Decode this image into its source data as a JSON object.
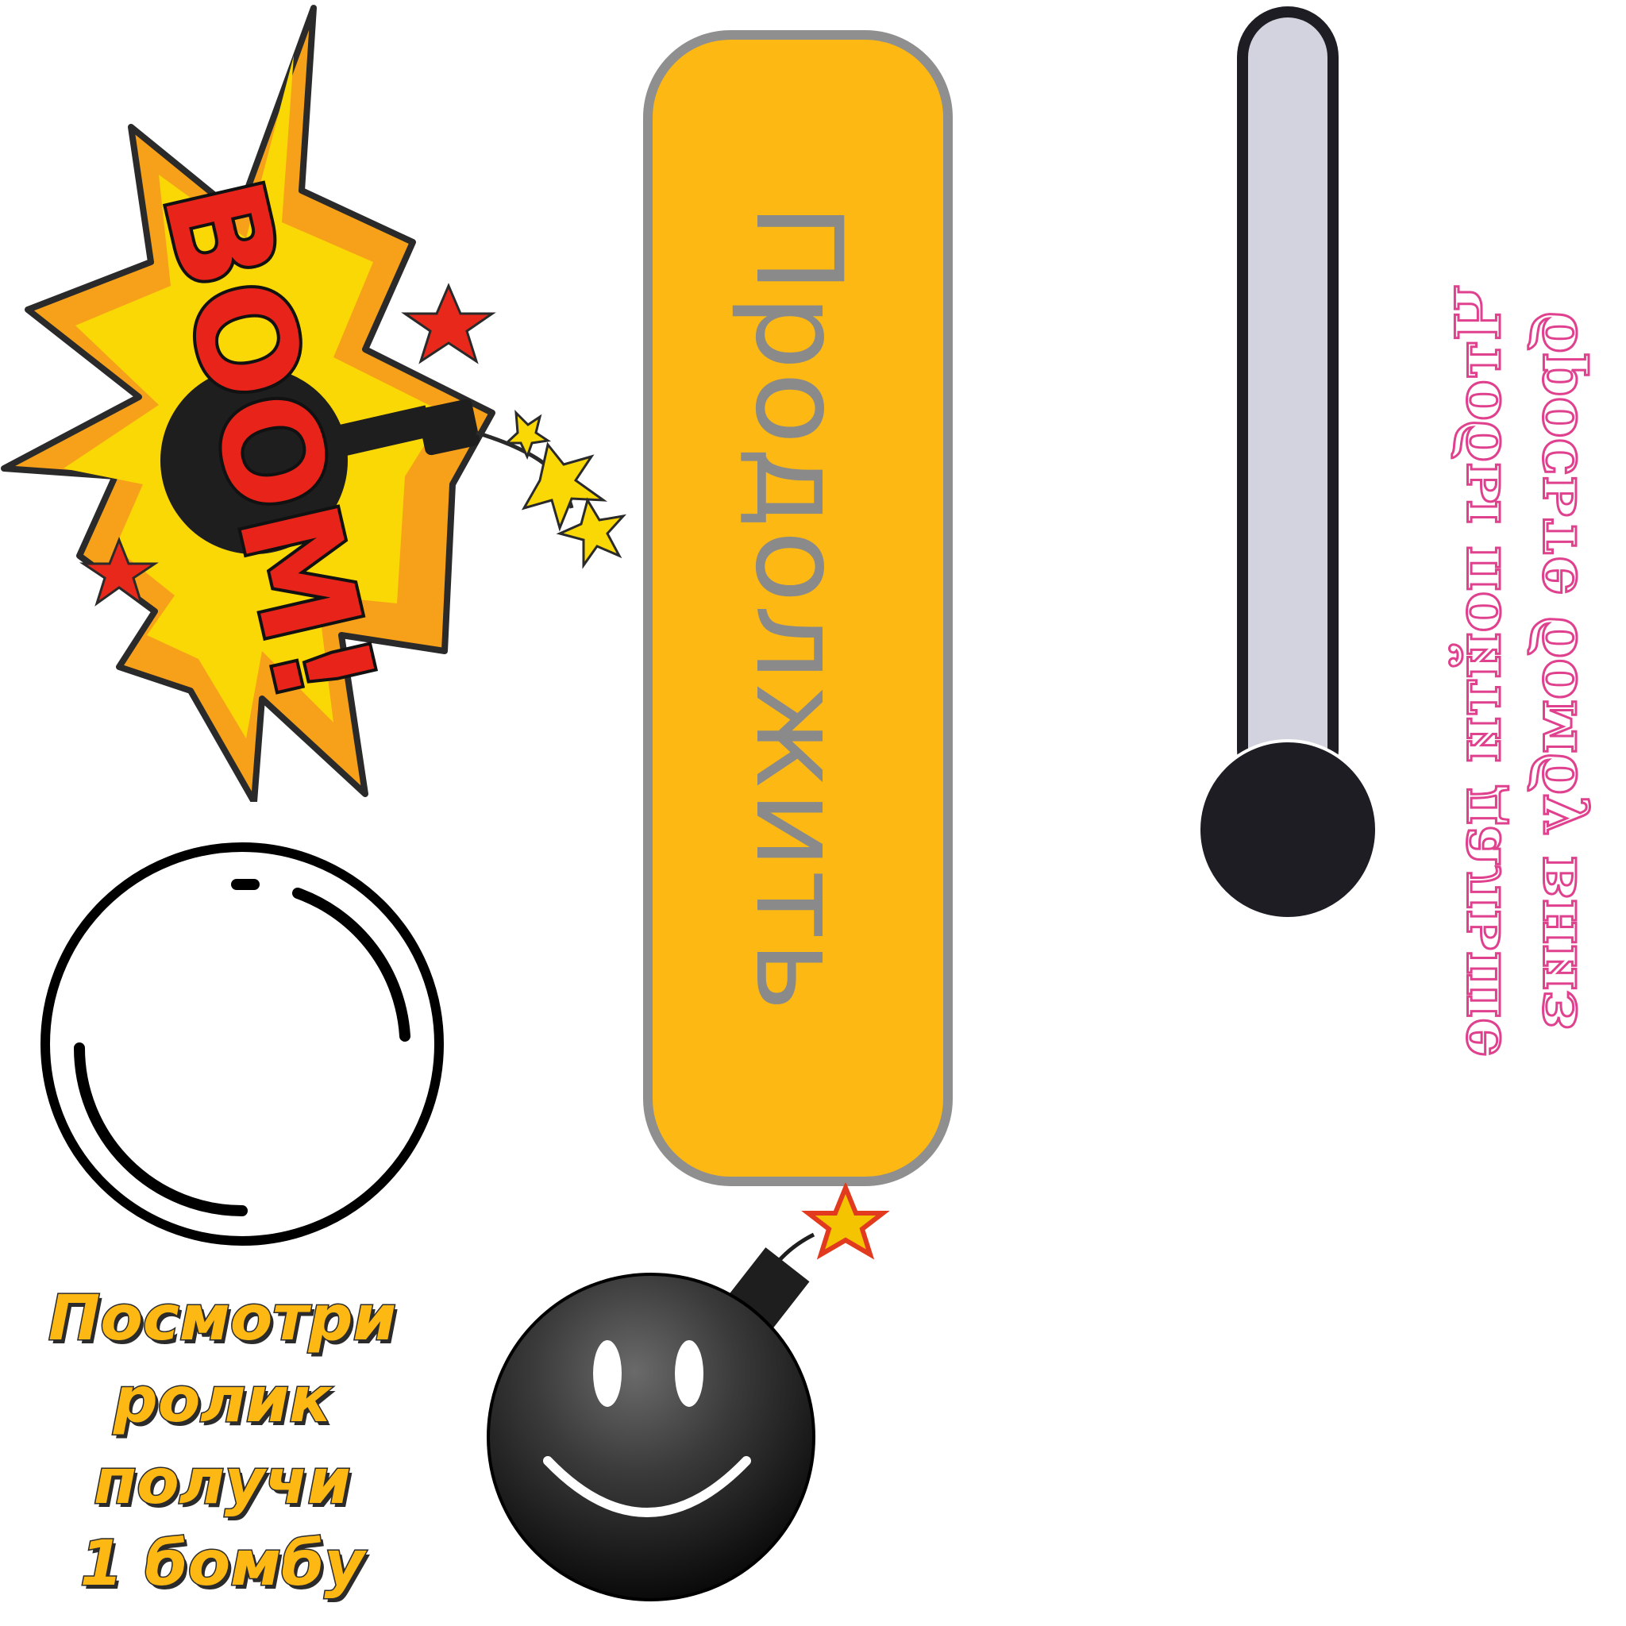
{
  "boom": {
    "text": "BOOM!",
    "icon": "boom-explosion-icon"
  },
  "continue_button": {
    "label": "Продолжить",
    "color": "#fdb813",
    "border_color": "#8f8f8f",
    "text_color": "#8a8a8a"
  },
  "power_slider": {
    "track_color": "#d3d3df",
    "knob_color": "#1e1d24",
    "level": 0.0
  },
  "hint": {
    "lines": [
      "Чтобы пойти дальше",
      "бросьте бомбу вниз"
    ],
    "color": "#e0418e"
  },
  "ring": {
    "icon": "empty-ring-icon"
  },
  "reward": {
    "lines": [
      "Посмотри",
      "ролик",
      "получи",
      "1 бомбу"
    ],
    "color": "#fdb813"
  },
  "bomb": {
    "icon": "smiley-bomb-icon"
  }
}
